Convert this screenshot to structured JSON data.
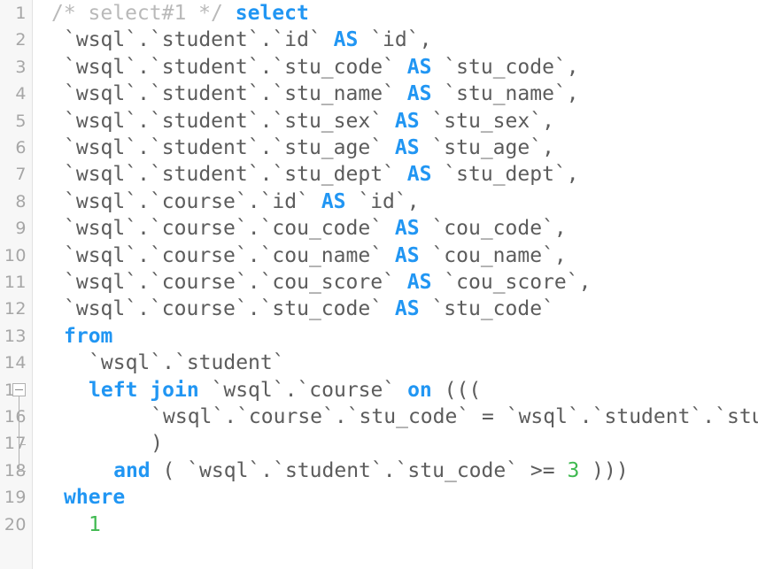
{
  "editor": {
    "language": "sql",
    "first_line": 1,
    "total_visible_lines": 20,
    "colors": {
      "background": "#ffffff",
      "gutter_background": "#f7f7f7",
      "gutter_border": "#e2e2e2",
      "line_number": "#a6a6a6",
      "identifier": "#5c5c5c",
      "keyword": "#2196f3",
      "number_literal": "#3fb950",
      "comment": "#b9b9b9",
      "fold_marker": "#b0b0b0"
    },
    "line_numbers": [
      "1",
      "2",
      "3",
      "4",
      "5",
      "6",
      "7",
      "8",
      "9",
      "10",
      "11",
      "12",
      "13",
      "14",
      "15",
      "16",
      "17",
      "18",
      "19",
      "20"
    ],
    "fold": {
      "marker_line": "15",
      "marker_glyph": "minus",
      "tick_line": "17",
      "end_line": "18",
      "state": "expanded"
    },
    "lines": [
      {
        "number": "1",
        "indent": 0,
        "tokens": [
          {
            "text": "/* select#1 */",
            "type": "comment"
          },
          {
            "text": " ",
            "type": "punc"
          },
          {
            "text": "select",
            "type": "kw"
          }
        ]
      },
      {
        "number": "2",
        "indent": 1,
        "tokens": [
          {
            "text": "`wsql`.`student`.`id` ",
            "type": "id"
          },
          {
            "text": "AS",
            "type": "kw"
          },
          {
            "text": " `id`,",
            "type": "id"
          }
        ]
      },
      {
        "number": "3",
        "indent": 1,
        "tokens": [
          {
            "text": "`wsql`.`student`.`stu_code` ",
            "type": "id"
          },
          {
            "text": "AS",
            "type": "kw"
          },
          {
            "text": " `stu_code`,",
            "type": "id"
          }
        ]
      },
      {
        "number": "4",
        "indent": 1,
        "tokens": [
          {
            "text": "`wsql`.`student`.`stu_name` ",
            "type": "id"
          },
          {
            "text": "AS",
            "type": "kw"
          },
          {
            "text": " `stu_name`,",
            "type": "id"
          }
        ]
      },
      {
        "number": "5",
        "indent": 1,
        "tokens": [
          {
            "text": "`wsql`.`student`.`stu_sex` ",
            "type": "id"
          },
          {
            "text": "AS",
            "type": "kw"
          },
          {
            "text": " `stu_sex`,",
            "type": "id"
          }
        ]
      },
      {
        "number": "6",
        "indent": 1,
        "tokens": [
          {
            "text": "`wsql`.`student`.`stu_age` ",
            "type": "id"
          },
          {
            "text": "AS",
            "type": "kw"
          },
          {
            "text": " `stu_age`,",
            "type": "id"
          }
        ]
      },
      {
        "number": "7",
        "indent": 1,
        "tokens": [
          {
            "text": "`wsql`.`student`.`stu_dept` ",
            "type": "id"
          },
          {
            "text": "AS",
            "type": "kw"
          },
          {
            "text": " `stu_dept`,",
            "type": "id"
          }
        ]
      },
      {
        "number": "8",
        "indent": 1,
        "tokens": [
          {
            "text": "`wsql`.`course`.`id` ",
            "type": "id"
          },
          {
            "text": "AS",
            "type": "kw"
          },
          {
            "text": " `id`,",
            "type": "id"
          }
        ]
      },
      {
        "number": "9",
        "indent": 1,
        "tokens": [
          {
            "text": "`wsql`.`course`.`cou_code` ",
            "type": "id"
          },
          {
            "text": "AS",
            "type": "kw"
          },
          {
            "text": " `cou_code`,",
            "type": "id"
          }
        ]
      },
      {
        "number": "10",
        "indent": 1,
        "tokens": [
          {
            "text": "`wsql`.`course`.`cou_name` ",
            "type": "id"
          },
          {
            "text": "AS",
            "type": "kw"
          },
          {
            "text": " `cou_name`,",
            "type": "id"
          }
        ]
      },
      {
        "number": "11",
        "indent": 1,
        "tokens": [
          {
            "text": "`wsql`.`course`.`cou_score` ",
            "type": "id"
          },
          {
            "text": "AS",
            "type": "kw"
          },
          {
            "text": " `cou_score`,",
            "type": "id"
          }
        ]
      },
      {
        "number": "12",
        "indent": 1,
        "tokens": [
          {
            "text": "`wsql`.`course`.`stu_code` ",
            "type": "id"
          },
          {
            "text": "AS",
            "type": "kw"
          },
          {
            "text": " `stu_code`",
            "type": "id"
          }
        ]
      },
      {
        "number": "13",
        "indent": 1,
        "tokens": [
          {
            "text": "from",
            "type": "kw"
          }
        ]
      },
      {
        "number": "14",
        "indent": 3,
        "tokens": [
          {
            "text": "`wsql`.`student`",
            "type": "id"
          }
        ]
      },
      {
        "number": "15",
        "indent": 3,
        "tokens": [
          {
            "text": "left join",
            "type": "kw"
          },
          {
            "text": " `wsql`.`course` ",
            "type": "id"
          },
          {
            "text": "on",
            "type": "kw"
          },
          {
            "text": " (((",
            "type": "punc"
          }
        ]
      },
      {
        "number": "16",
        "indent": 8,
        "tokens": [
          {
            "text": "`wsql`.`course`.`stu_code` = `wsql`.`student`.`stu_code`",
            "type": "id"
          }
        ]
      },
      {
        "number": "17",
        "indent": 8,
        "tokens": [
          {
            "text": ")",
            "type": "punc"
          }
        ]
      },
      {
        "number": "18",
        "indent": 5,
        "tokens": [
          {
            "text": "and",
            "type": "kw"
          },
          {
            "text": " ( `wsql`.`student`.`stu_code` >= ",
            "type": "id"
          },
          {
            "text": "3",
            "type": "num"
          },
          {
            "text": " )))",
            "type": "punc"
          }
        ]
      },
      {
        "number": "19",
        "indent": 1,
        "tokens": [
          {
            "text": "where",
            "type": "kw"
          }
        ]
      },
      {
        "number": "20",
        "indent": 3,
        "tokens": [
          {
            "text": "1",
            "type": "num"
          }
        ]
      }
    ]
  }
}
